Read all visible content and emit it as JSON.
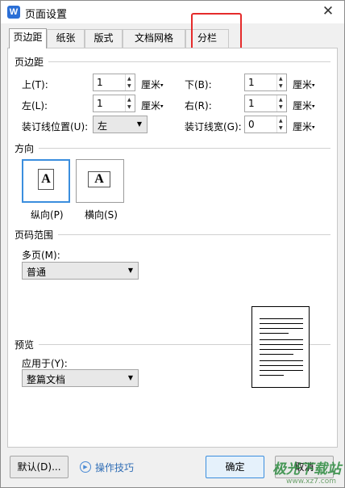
{
  "window": {
    "title": "页面设置",
    "close_glyph": "✕",
    "app_icon_letter": "W"
  },
  "tabs": [
    {
      "label": "页边距",
      "active": true
    },
    {
      "label": "纸张",
      "active": false
    },
    {
      "label": "版式",
      "active": false
    },
    {
      "label": "文档网格",
      "active": false
    },
    {
      "label": "分栏",
      "active": false
    }
  ],
  "margins": {
    "section_title": "页边距",
    "top_label": "上(T):",
    "top_value": "1",
    "top_unit": "厘米",
    "bottom_label": "下(B):",
    "bottom_value": "1",
    "bottom_unit": "厘米",
    "left_label": "左(L):",
    "left_value": "1",
    "left_unit": "厘米",
    "right_label": "右(R):",
    "right_value": "1",
    "right_unit": "厘米",
    "gutter_pos_label": "装订线位置(U):",
    "gutter_pos_value": "左",
    "gutter_width_label": "装订线宽(G):",
    "gutter_width_value": "0",
    "gutter_width_unit": "厘米"
  },
  "orientation": {
    "section_title": "方向",
    "portrait_label": "纵向(P)",
    "landscape_label": "横向(S)",
    "glyph": "A",
    "selected": "portrait"
  },
  "page_range": {
    "section_title": "页码范围",
    "multi_label": "多页(M):",
    "multi_value": "普通"
  },
  "preview": {
    "section_title": "预览",
    "apply_label": "应用于(Y):",
    "apply_value": "整篇文档"
  },
  "footer": {
    "default_btn": "默认(D)...",
    "help_link": "操作技巧",
    "ok_btn": "确定",
    "cancel_btn": "取消"
  },
  "watermark": {
    "text": "极光下载站",
    "sub": "www.xz7.com"
  },
  "colors": {
    "accent": "#3b8ede",
    "highlight": "#e52b2b"
  }
}
